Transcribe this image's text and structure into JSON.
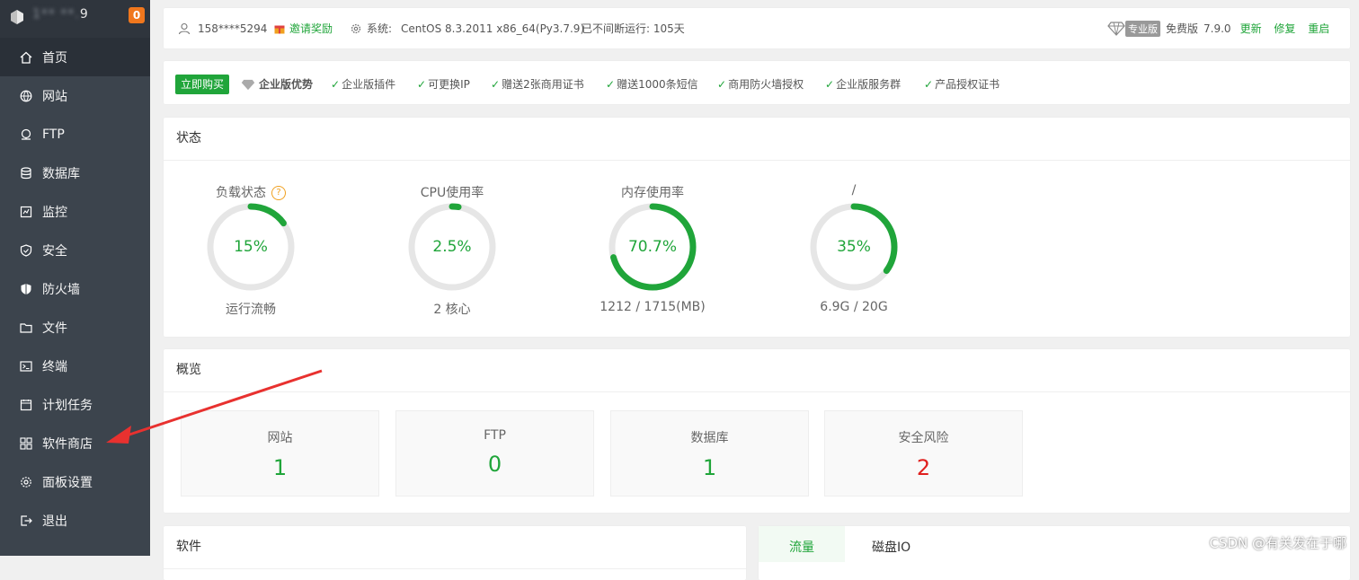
{
  "sidebar": {
    "ip_visible_end": "9",
    "ip_hidden": "1** **.",
    "badge": "0",
    "items": [
      {
        "label": "首页",
        "icon": "home-icon",
        "active": true
      },
      {
        "label": "网站",
        "icon": "globe-icon"
      },
      {
        "label": "FTP",
        "icon": "ftp-icon"
      },
      {
        "label": "数据库",
        "icon": "database-icon"
      },
      {
        "label": "监控",
        "icon": "monitor-icon"
      },
      {
        "label": "安全",
        "icon": "shield-icon"
      },
      {
        "label": "防火墙",
        "icon": "firewall-icon"
      },
      {
        "label": "文件",
        "icon": "folder-icon"
      },
      {
        "label": "终端",
        "icon": "terminal-icon"
      },
      {
        "label": "计划任务",
        "icon": "calendar-icon"
      },
      {
        "label": "软件商店",
        "icon": "grid-icon"
      },
      {
        "label": "面板设置",
        "icon": "gear-icon"
      },
      {
        "label": "退出",
        "icon": "logout-icon"
      }
    ]
  },
  "topbar": {
    "user": "158****5294",
    "invite": "邀请奖励",
    "system_label": "系统:",
    "system_value": "CentOS 8.3.2011 x86_64(Py3.7.9)",
    "uptime": "已不间断运行: 105天",
    "pro_tag": "专业版",
    "edition": "免费版",
    "version": "7.9.0",
    "update": "更新",
    "repair": "修复",
    "restart": "重启"
  },
  "enterprise": {
    "buy": "立即购买",
    "title": "企业版优势",
    "features": [
      "企业版插件",
      "可更换IP",
      "赠送2张商用证书",
      "赠送1000条短信",
      "商用防火墙授权",
      "企业版服务群",
      "产品授权证书"
    ]
  },
  "status": {
    "title": "状态",
    "gauges": [
      {
        "label": "负载状态",
        "value": "15%",
        "percent": 15,
        "sub": "运行流畅",
        "help": "?"
      },
      {
        "label": "CPU使用率",
        "value": "2.5%",
        "percent": 2.5,
        "sub": "2 核心"
      },
      {
        "label": "内存使用率",
        "value": "70.7%",
        "percent": 70.7,
        "sub": "1212 / 1715(MB)"
      },
      {
        "label": "/",
        "value": "35%",
        "percent": 35,
        "sub": "6.9G / 20G"
      }
    ]
  },
  "overview": {
    "title": "概览",
    "boxes": [
      {
        "label": "网站",
        "value": "1"
      },
      {
        "label": "FTP",
        "value": "0"
      },
      {
        "label": "数据库",
        "value": "1"
      },
      {
        "label": "安全风险",
        "value": "2",
        "alert": true
      }
    ]
  },
  "software": {
    "title": "软件"
  },
  "traffic": {
    "tab_active": "流量",
    "tab_other": "磁盘IO"
  },
  "watermark": "CSDN @有关发在于哪"
}
